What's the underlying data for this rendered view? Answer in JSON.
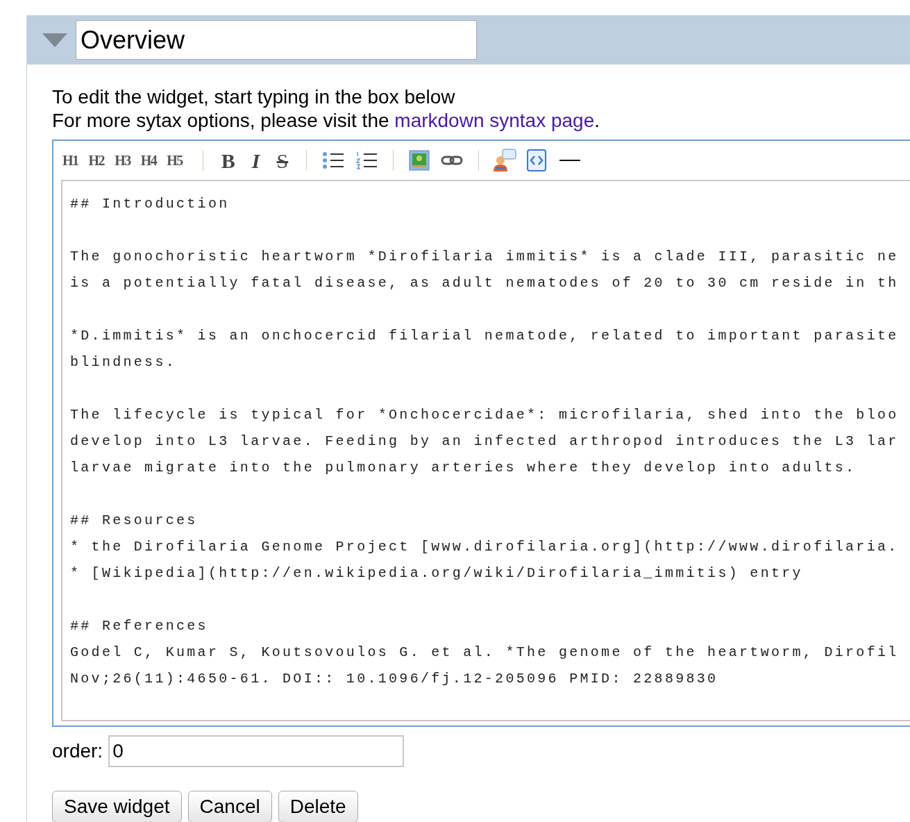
{
  "widget": {
    "title": "Overview",
    "expanded": true
  },
  "instructions": [
    {
      "text": "To edit the widget, start typing in the box below"
    },
    {
      "text": "For more sytax options, please visit the ",
      "link": "markdown syntax page",
      "after": "."
    }
  ],
  "toolbar": {
    "headings": [
      "H1",
      "H2",
      "H3",
      "H4",
      "H5"
    ],
    "format_buttons": [
      {
        "kind": "bold",
        "label": "B"
      },
      {
        "kind": "italic",
        "label": "I"
      },
      {
        "kind": "strike",
        "label": "S"
      }
    ]
  },
  "editor_blocks": [
    [
      "## Introduction"
    ],
    [
      "The gonochoristic heartworm *Dirofilaria immitis* is a clade III, parasitic ne",
      "is a potentially fatal disease, as adult nematodes of 20 to 30 cm reside in th"
    ],
    [
      "*D.immitis* is an onchocercid filarial nematode, related to important parasite",
      "blindness."
    ],
    [
      "The lifecycle is typical for *Onchocercidae*: microfilaria, shed into the bloo",
      "develop into L3 larvae. Feeding by an infected arthropod introduces the L3 lar",
      "larvae migrate into the pulmonary arteries where they develop into adults."
    ],
    [
      "## Resources",
      "* the Dirofilaria Genome Project [www.dirofilaria.org](http://www.dirofilaria.",
      "* [Wikipedia](http://en.wikipedia.org/wiki/Dirofilaria_immitis) entry"
    ],
    [
      "## References",
      "Godel C, Kumar S, Koutsovoulos G. et al. *The genome of the heartworm, Dirofil",
      "Nov;26(11):4650-61. DOI:: 10.1096/fj.12-205096 PMID: 22889830"
    ]
  ],
  "order": {
    "label": "order:",
    "value": "0"
  },
  "buttons": [
    "Save widget",
    "Cancel",
    "Delete"
  ]
}
